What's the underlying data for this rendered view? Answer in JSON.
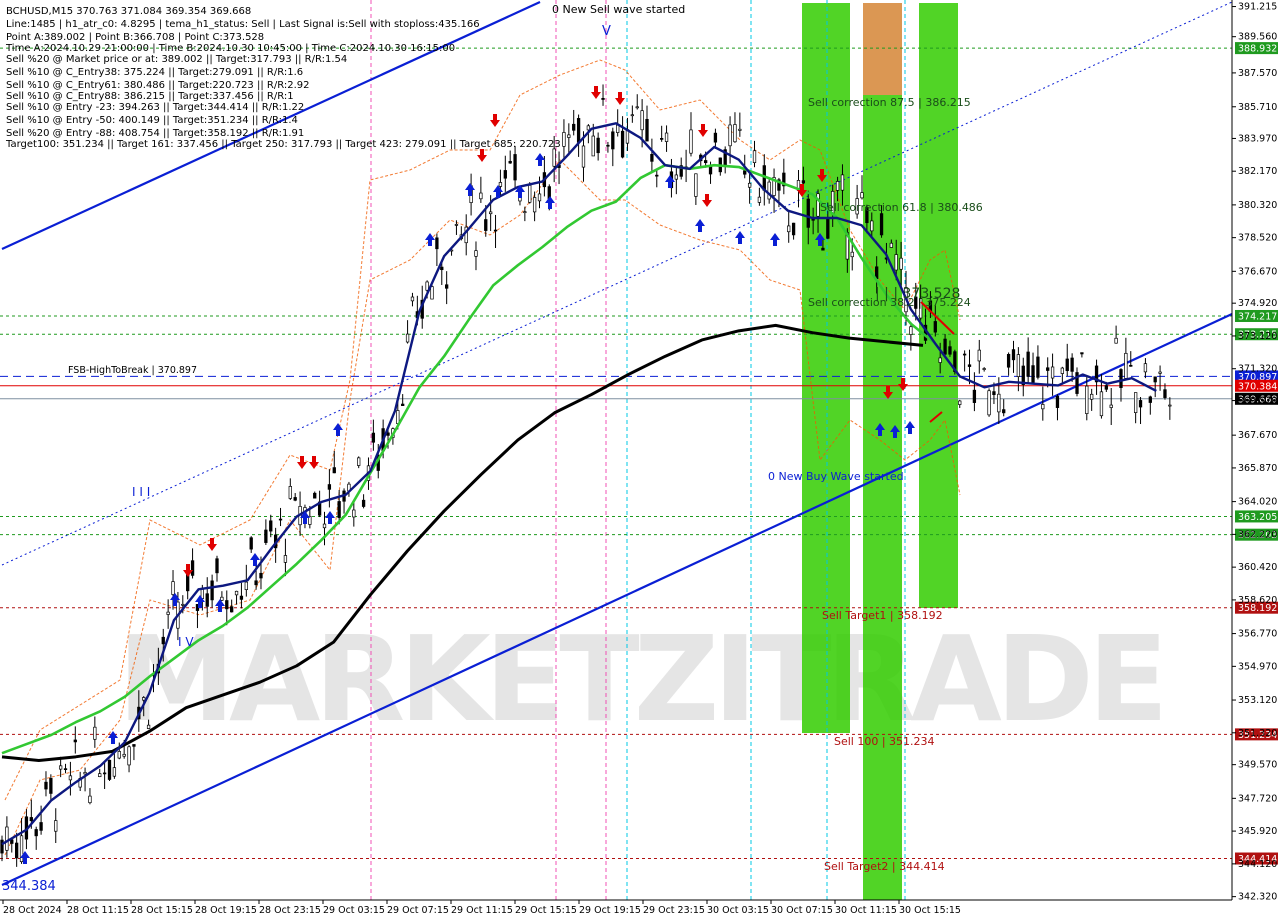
{
  "colors": {
    "background": "#ffffff",
    "text": "#000000",
    "blue": "#0a1fd4",
    "dark_blue": "#0d1880",
    "green_ma": "#32c832",
    "black_ma": "#000000",
    "red": "#e00000",
    "dark_red": "#b01010",
    "green_level": "#1f9a1f",
    "green_zone": "#33cc00",
    "orange_zone": "#d9914a",
    "cyan": "#00c8e6",
    "magenta": "#f050b4",
    "orange_dotted": "#f05a00",
    "watermark": "#d9d9d9",
    "candle": "#000000"
  },
  "header": {
    "lines": [
      "BCHUSD,M15  370.763 371.084 369.354 369.668",
      "Line:1485 | h1_atr_c0: 4.8295 | tema_h1_status: Sell | Last Signal is:Sell with stoploss:435.166",
      "Point A:389.002 | Point B:366.708 | Point C:373.528",
      "Time A:2024.10.29 21:00:00 | Time B:2024.10.30 10:45:00 | Time C:2024.10.30 16:15:00",
      "Sell %20 @ Market price or at: 389.002 || Target:317.793 || R/R:1.54",
      "Sell %10 @ C_Entry38: 375.224 || Target:279.091 || R/R:1.6",
      "Sell %10 @ C_Entry61: 380.486 || Target:220.723 || R/R:2.92",
      "Sell %10 @ C_Entry88: 386.215 || Target:337.456 || R/R:1",
      "Sell %10 @ Entry -23: 394.263 || Target:344.414 || R/R:1.22",
      "Sell %10 @ Entry -50: 400.149 || Target:351.234 || R/R:1.4",
      "Sell %20 @ Entry -88: 408.754 || Target:358.192 || R/R:1.91",
      "Target100: 351.234 || Target 161: 337.456 || Target 250: 317.793 || Target 423: 279.091 || Target 685: 220.723"
    ]
  },
  "watermark": {
    "text": "MARKETZITRADE"
  },
  "annotations": {
    "sell_wave": "0 New Sell wave started",
    "buy_wave": "0 New Buy Wave started",
    "fsb": "FSB-HighToBreak | 370.897",
    "correction_875": "Sell correction 87.5 | 386.215",
    "correction_618": "Sell correction 61.8 | 380.486",
    "correction_382": "Sell correction 38.2 | 375.224",
    "point_c": "| | | 373.528",
    "sell_target1": "Sell Target1 | 358.192",
    "sell_100": "Sell 100 | 351.234",
    "sell_target2": "Sell Target2 | 344.414",
    "low_label": "344.384",
    "wave_I": "I I I",
    "wave_V": "I V",
    "top_v": "V"
  },
  "chart_data": {
    "type": "candlestick",
    "symbol": "BCHUSD",
    "timeframe": "M15",
    "ohlc_last": {
      "open": 370.763,
      "high": 371.084,
      "low": 369.354,
      "close": 369.668
    },
    "ylim": [
      342.3,
      391.3
    ],
    "y_ticks": [
      391.215,
      389.56,
      387.57,
      385.71,
      383.97,
      382.17,
      380.32,
      378.52,
      376.67,
      374.92,
      373.12,
      371.32,
      369.57,
      367.67,
      365.87,
      364.02,
      362.22,
      360.42,
      358.62,
      356.77,
      354.97,
      353.12,
      351.32,
      349.57,
      347.72,
      345.92,
      344.12,
      342.32
    ],
    "x_tick_labels": [
      "28 Oct 2024",
      "28 Oct 11:15",
      "28 Oct 15:15",
      "28 Oct 19:15",
      "28 Oct 23:15",
      "29 Oct 03:15",
      "29 Oct 07:15",
      "29 Oct 11:15",
      "29 Oct 15:15",
      "29 Oct 19:15",
      "29 Oct 23:15",
      "30 Oct 03:15",
      "30 Oct 07:15",
      "30 Oct 11:15",
      "30 Oct 15:15"
    ],
    "price_levels": [
      {
        "price": 388.932,
        "label": "388.932",
        "style": "dotted",
        "color": "#1f9a1f"
      },
      {
        "price": 374.217,
        "label": "374.217",
        "style": "dotted",
        "color": "#1f9a1f"
      },
      {
        "price": 373.215,
        "label": "373.215",
        "style": "dotted",
        "color": "#1f9a1f"
      },
      {
        "price": 370.897,
        "label": "370.897",
        "style": "dashed",
        "color": "#0a1fd4"
      },
      {
        "price": 370.384,
        "label": "370.384",
        "style": "solid",
        "color": "#e00000"
      },
      {
        "price": 369.668,
        "label": "369.668",
        "style": "solid",
        "color": "#7f8fa0"
      },
      {
        "price": 363.205,
        "label": "363.205",
        "style": "dotted",
        "color": "#1f9a1f"
      },
      {
        "price": 362.203,
        "label": "362.203",
        "style": "dotted",
        "color": "#1f9a1f"
      },
      {
        "price": 358.192,
        "label": "358.192",
        "style": "dotted",
        "color": "#b01010"
      },
      {
        "price": 351.234,
        "label": "351.234",
        "style": "dotted",
        "color": "#b01010"
      },
      {
        "price": 344.414,
        "label": "344.414",
        "style": "dotted",
        "color": "#b01010"
      }
    ],
    "ema_blue": [
      [
        0,
        345.2
      ],
      [
        0.02,
        346.0
      ],
      [
        0.04,
        347.6
      ],
      [
        0.06,
        348.6
      ],
      [
        0.08,
        349.5
      ],
      [
        0.1,
        350.8
      ],
      [
        0.12,
        353.5
      ],
      [
        0.14,
        357.5
      ],
      [
        0.16,
        359.2
      ],
      [
        0.18,
        359.4
      ],
      [
        0.2,
        359.7
      ],
      [
        0.22,
        361.5
      ],
      [
        0.24,
        363.2
      ],
      [
        0.26,
        364.0
      ],
      [
        0.28,
        364.4
      ],
      [
        0.3,
        365.7
      ],
      [
        0.32,
        369.0
      ],
      [
        0.34,
        374.5
      ],
      [
        0.36,
        377.5
      ],
      [
        0.38,
        379.0
      ],
      [
        0.4,
        380.6
      ],
      [
        0.42,
        381.3
      ],
      [
        0.44,
        381.6
      ],
      [
        0.46,
        383.0
      ],
      [
        0.48,
        384.5
      ],
      [
        0.5,
        384.8
      ],
      [
        0.52,
        384.0
      ],
      [
        0.54,
        382.5
      ],
      [
        0.56,
        382.3
      ],
      [
        0.58,
        383.5
      ],
      [
        0.6,
        382.8
      ],
      [
        0.62,
        381.2
      ],
      [
        0.64,
        380.0
      ],
      [
        0.66,
        379.6
      ],
      [
        0.68,
        379.6
      ],
      [
        0.7,
        379.2
      ],
      [
        0.72,
        377.6
      ],
      [
        0.74,
        374.6
      ],
      [
        0.76,
        372.7
      ],
      [
        0.78,
        370.9
      ],
      [
        0.8,
        370.3
      ],
      [
        0.82,
        370.6
      ],
      [
        0.84,
        370.5
      ],
      [
        0.86,
        370.4
      ],
      [
        0.88,
        371.0
      ],
      [
        0.9,
        370.5
      ],
      [
        0.92,
        370.8
      ],
      [
        0.94,
        370.1
      ]
    ],
    "ema_green": [
      [
        0,
        350.2
      ],
      [
        0.02,
        350.7
      ],
      [
        0.04,
        351.2
      ],
      [
        0.06,
        351.9
      ],
      [
        0.08,
        352.5
      ],
      [
        0.1,
        353.3
      ],
      [
        0.12,
        354.4
      ],
      [
        0.14,
        355.4
      ],
      [
        0.16,
        356.4
      ],
      [
        0.18,
        357.2
      ],
      [
        0.2,
        358.2
      ],
      [
        0.22,
        359.4
      ],
      [
        0.24,
        360.6
      ],
      [
        0.26,
        361.9
      ],
      [
        0.28,
        363.3
      ],
      [
        0.3,
        365.6
      ],
      [
        0.32,
        367.9
      ],
      [
        0.34,
        370.3
      ],
      [
        0.36,
        372.0
      ],
      [
        0.38,
        374.0
      ],
      [
        0.4,
        375.9
      ],
      [
        0.42,
        377.0
      ],
      [
        0.44,
        378.0
      ],
      [
        0.46,
        379.1
      ],
      [
        0.48,
        380.0
      ],
      [
        0.5,
        380.5
      ],
      [
        0.52,
        381.8
      ],
      [
        0.54,
        382.5
      ],
      [
        0.56,
        382.3
      ],
      [
        0.58,
        382.5
      ],
      [
        0.6,
        382.4
      ],
      [
        0.62,
        381.9
      ],
      [
        0.64,
        381.4
      ],
      [
        0.66,
        380.9
      ],
      [
        0.68,
        379.6
      ],
      [
        0.7,
        377.4
      ],
      [
        0.72,
        375.4
      ],
      [
        0.74,
        373.8
      ],
      [
        0.76,
        372.7
      ]
    ],
    "ema_black": [
      [
        0,
        350.0
      ],
      [
        0.03,
        349.8
      ],
      [
        0.06,
        350.0
      ],
      [
        0.09,
        350.3
      ],
      [
        0.12,
        351.4
      ],
      [
        0.15,
        352.7
      ],
      [
        0.18,
        353.4
      ],
      [
        0.21,
        354.1
      ],
      [
        0.24,
        355.0
      ],
      [
        0.27,
        356.3
      ],
      [
        0.3,
        358.9
      ],
      [
        0.33,
        361.3
      ],
      [
        0.36,
        363.5
      ],
      [
        0.39,
        365.5
      ],
      [
        0.42,
        367.4
      ],
      [
        0.45,
        368.9
      ],
      [
        0.48,
        369.9
      ],
      [
        0.51,
        371.0
      ],
      [
        0.54,
        372.0
      ],
      [
        0.57,
        372.9
      ],
      [
        0.6,
        373.4
      ],
      [
        0.63,
        373.7
      ],
      [
        0.66,
        373.3
      ],
      [
        0.69,
        373.0
      ],
      [
        0.72,
        372.8
      ],
      [
        0.75,
        372.6
      ]
    ]
  }
}
